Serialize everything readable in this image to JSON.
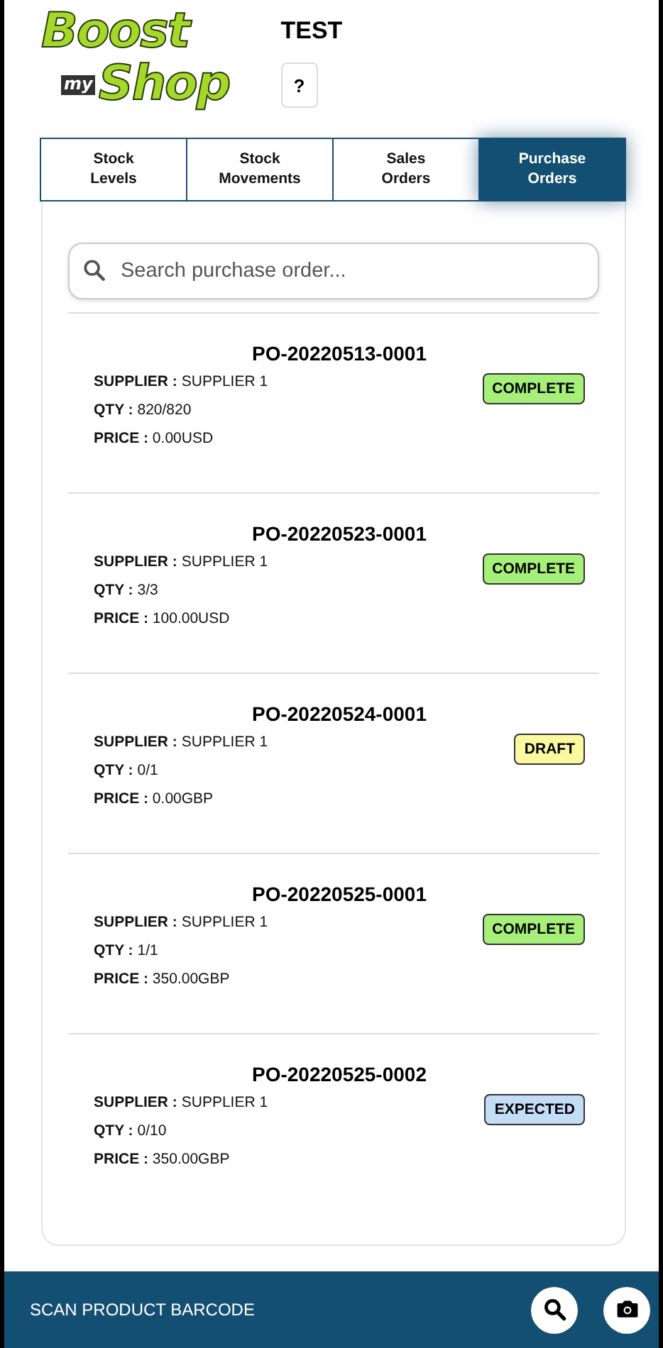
{
  "logo": {
    "line_1": "Boost",
    "line_2": "my",
    "line_3": "Shop"
  },
  "store_name": "TEST",
  "help_button": "?",
  "tabs": [
    {
      "label": "Stock\nLevels",
      "selected": false
    },
    {
      "label": "Stock\nMovements",
      "selected": false
    },
    {
      "label": "Sales\nOrders",
      "selected": false
    },
    {
      "label": "Purchase\nOrders",
      "selected": true
    }
  ],
  "search": {
    "placeholder": "Search purchase order..."
  },
  "orders": [
    {
      "number": "PO-20220513-0001",
      "details": [
        "**SUPPLIER :** SUPPLIER 1",
        "**QTY :** 820/820",
        "**PRICE :** 0.00USD"
      ],
      "status": {
        "label": "COMPLETE",
        "color": "#a6f07a"
      }
    },
    {
      "number": "PO-20220523-0001",
      "details": [
        "**SUPPLIER :** SUPPLIER 1",
        "**QTY :** 3/3",
        "**PRICE :** 100.00USD"
      ],
      "status": {
        "label": "COMPLETE",
        "color": "#a6f07a"
      }
    },
    {
      "number": "PO-20220524-0001",
      "details": [
        "**SUPPLIER :** SUPPLIER 1",
        "**QTY :** 0/1",
        "**PRICE :** 0.00GBP"
      ],
      "status": {
        "label": "DRAFT",
        "color": "#fbf9a0"
      }
    },
    {
      "number": "PO-20220525-0001",
      "details": [
        "**SUPPLIER :** SUPPLIER 1",
        "**QTY :** 1/1",
        "**PRICE :** 350.00GBP"
      ],
      "status": {
        "label": "COMPLETE",
        "color": "#a6f07a"
      }
    },
    {
      "number": "PO-20220525-0002",
      "details": [
        "**SUPPLIER :** SUPPLIER 1",
        "**QTY :** 0/10",
        "**PRICE :** 350.00GBP"
      ],
      "status": {
        "label": "EXPECTED",
        "color": "#c4ddf7"
      }
    }
  ],
  "bottom_bar": {
    "label": "SCAN PRODUCT BARCODE"
  }
}
